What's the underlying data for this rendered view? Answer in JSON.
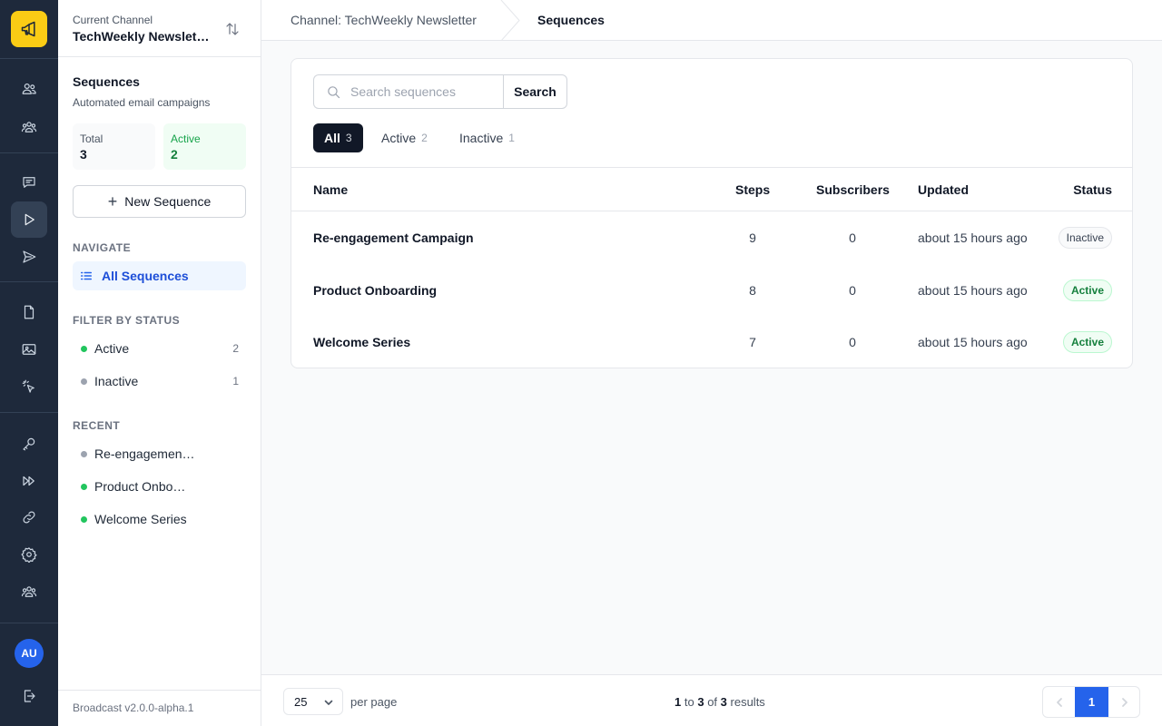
{
  "sidebar": {
    "channel_label": "Current Channel",
    "channel_name": "TechWeekly Newsletter",
    "section_title": "Sequences",
    "section_subtitle": "Automated email campaigns",
    "stats": {
      "total_label": "Total",
      "total_value": "3",
      "active_label": "Active",
      "active_value": "2"
    },
    "new_button": "New Sequence",
    "navigate_heading": "NAVIGATE",
    "nav_all": "All Sequences",
    "filter_heading": "FILTER BY STATUS",
    "filters": [
      {
        "label": "Active",
        "count": "2"
      },
      {
        "label": "Inactive",
        "count": "1"
      }
    ],
    "recent_heading": "RECENT",
    "recent": [
      {
        "label": "Re-engagement Campaign"
      },
      {
        "label": "Product Onboarding"
      },
      {
        "label": "Welcome Series"
      }
    ],
    "version": "Broadcast v2.0.0-alpha.1"
  },
  "rail": {
    "avatar": "AU"
  },
  "breadcrumb": {
    "channel": "Channel: TechWeekly Newsletter",
    "current": "Sequences"
  },
  "search": {
    "placeholder": "Search sequences",
    "button": "Search"
  },
  "tabs": [
    {
      "label": "All",
      "count": "3"
    },
    {
      "label": "Active",
      "count": "2"
    },
    {
      "label": "Inactive",
      "count": "1"
    }
  ],
  "table": {
    "headers": {
      "name": "Name",
      "steps": "Steps",
      "subscribers": "Subscribers",
      "updated": "Updated",
      "status": "Status"
    },
    "rows": [
      {
        "name": "Re-engagement Campaign",
        "steps": "9",
        "subscribers": "0",
        "updated": "about 15 hours ago",
        "status": "Inactive"
      },
      {
        "name": "Product Onboarding",
        "steps": "8",
        "subscribers": "0",
        "updated": "about 15 hours ago",
        "status": "Active"
      },
      {
        "name": "Welcome Series",
        "steps": "7",
        "subscribers": "0",
        "updated": "about 15 hours ago",
        "status": "Active"
      }
    ]
  },
  "footer": {
    "per_page": "25",
    "per_page_label": "per page",
    "results_from": "1",
    "results_to_word": "to",
    "results_to": "3",
    "results_of_word": "of",
    "results_total": "3",
    "results_word": "results",
    "current_page": "1"
  },
  "colors": {
    "rail_bg": "#1e293b",
    "brand_yellow": "#facc15",
    "accent_blue": "#2563eb",
    "active_green": "#22c55e",
    "inactive_gray": "#9ca3af"
  }
}
